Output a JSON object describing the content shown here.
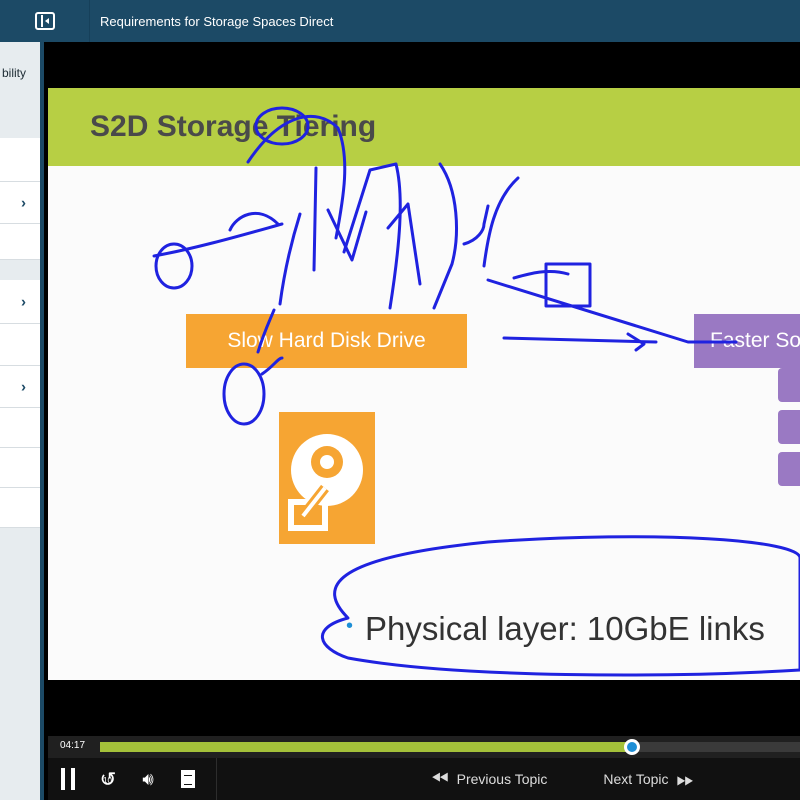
{
  "window": {
    "title": "Requirements for Storage Spaces Direct"
  },
  "sidebar": {
    "partial_text": "bility"
  },
  "slide": {
    "title": "S2D Storage Tiering",
    "slow_label": "Slow Hard Disk Drive",
    "fast_label": "Faster So",
    "bullet": "Physical layer: 10GbE links"
  },
  "player": {
    "current_time": "04:17",
    "progress": 0.76,
    "prev_label": "Previous Topic",
    "next_label": "Next Topic",
    "replay_label": "10"
  },
  "colors": {
    "header": "#1c4a66",
    "slide_band": "#b7cf44",
    "orange": "#f6a533",
    "purple": "#9a79c3",
    "ink": "#1f22e0",
    "progress": "#a4c13a"
  },
  "icons": [
    "sidebar-toggle-icon",
    "chevron-right-icon",
    "pause-icon",
    "replay-10-icon",
    "volume-icon",
    "notes-icon",
    "previous-icon",
    "next-icon",
    "hard-disk-icon"
  ]
}
